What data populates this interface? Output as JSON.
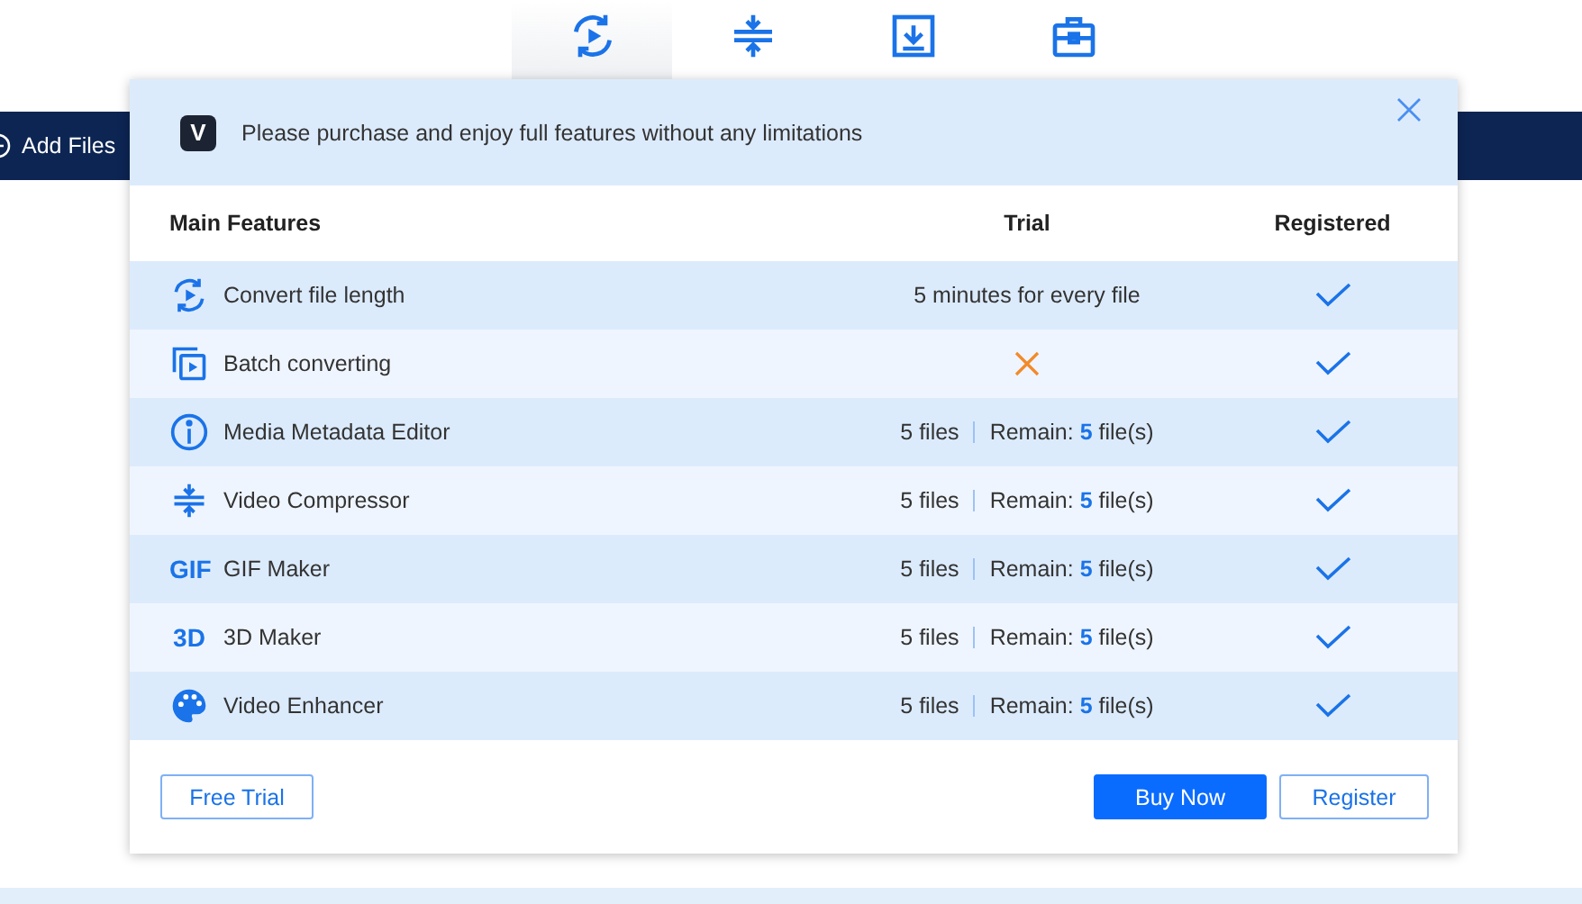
{
  "tabs": [
    {
      "kind": "convert",
      "selected": true
    },
    {
      "kind": "compress",
      "selected": false
    },
    {
      "kind": "download",
      "selected": false
    },
    {
      "kind": "toolbox",
      "selected": false
    }
  ],
  "toolbar": {
    "add_files": "Add Files"
  },
  "dialog": {
    "logo": "V",
    "message": "Please purchase and enjoy full features without any limitations",
    "columns": [
      "Main Features",
      "Trial",
      "Registered"
    ],
    "rows": [
      {
        "kind": "convert",
        "feature": "Convert file length",
        "trial": {
          "kind": "text",
          "text": "5 minutes for every file"
        },
        "registered": true
      },
      {
        "kind": "batch",
        "feature": "Batch converting",
        "trial": {
          "kind": "cross"
        },
        "registered": true
      },
      {
        "kind": "info",
        "feature": "Media Metadata Editor",
        "trial": {
          "kind": "quota",
          "files": "5 files",
          "remain": "Remain: **5** file(s)"
        },
        "registered": true
      },
      {
        "kind": "compress",
        "feature": "Video Compressor",
        "trial": {
          "kind": "quota",
          "files": "5 files",
          "remain": "Remain: **5** file(s)"
        },
        "registered": true
      },
      {
        "kind": "text",
        "badge": "GIF",
        "feature": "GIF Maker",
        "trial": {
          "kind": "quota",
          "files": "5 files",
          "remain": "Remain: **5** file(s)"
        },
        "registered": true
      },
      {
        "kind": "text",
        "badge": "3D",
        "feature": "3D Maker",
        "trial": {
          "kind": "quota",
          "files": "5 files",
          "remain": "Remain: **5** file(s)"
        },
        "registered": true
      },
      {
        "kind": "palette",
        "feature": "Video Enhancer",
        "trial": {
          "kind": "quota",
          "files": "5 files",
          "remain": "Remain: **5** file(s)"
        },
        "registered": true
      }
    ],
    "buttons": [
      {
        "label": "Free Trial",
        "kind": "outline"
      },
      {
        "label": "Buy Now",
        "kind": "primary"
      },
      {
        "label": "Register",
        "kind": "outline"
      }
    ]
  }
}
